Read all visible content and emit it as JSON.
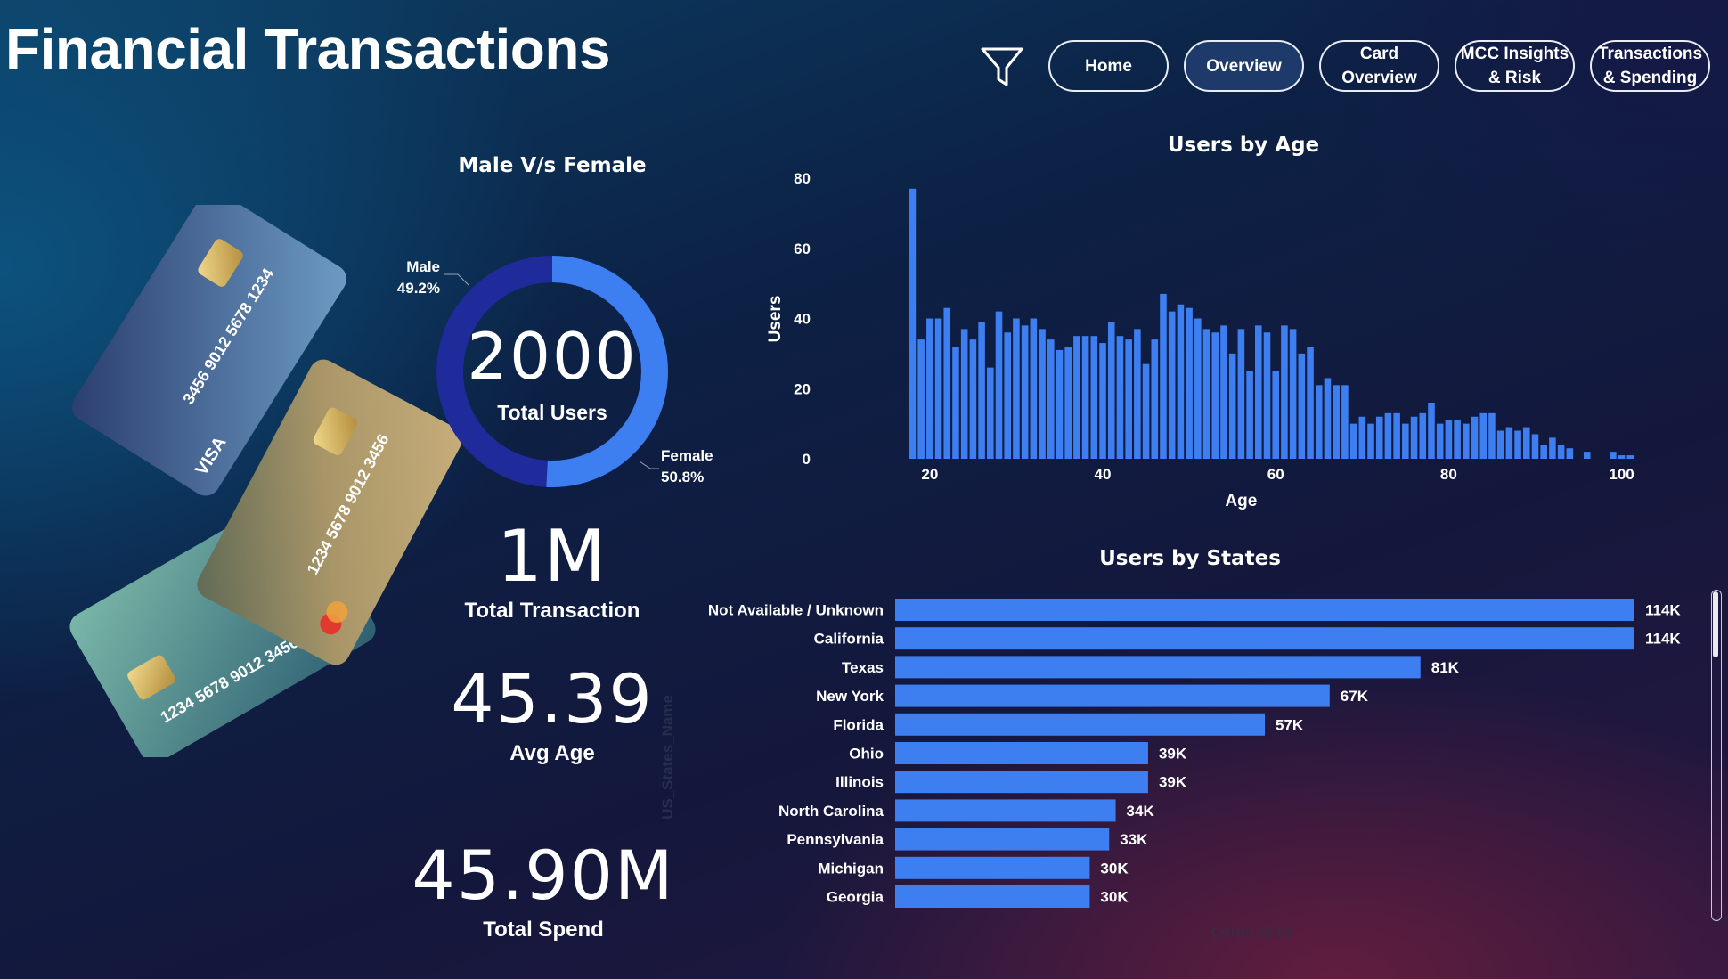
{
  "app_title": "Financial Transactions",
  "nav": {
    "filter_icon": "funnel-icon",
    "home": "Home",
    "overview": "Overview",
    "card_overview_line1": "Card",
    "card_overview_line2": "Overview",
    "mcc_line1": "MCC Insights",
    "mcc_line2": "& Risk",
    "trans_line1": "Transactions",
    "trans_line2": "& Spending",
    "active": "Overview"
  },
  "gender": {
    "title": "Male V/s Female",
    "total_users": "2000",
    "total_users_label": "Total Users",
    "male_label": "Male",
    "male_pct_text": "49.2%",
    "male_pct": 49.2,
    "female_label": "Female",
    "female_pct_text": "50.8%",
    "female_pct": 50.8,
    "male_color": "#1f2a9b",
    "female_color": "#3d7ef0"
  },
  "kpis": {
    "total_transaction": "1M",
    "total_transaction_label": "Total Transaction",
    "avg_age": "45.39",
    "avg_age_label": "Avg Age",
    "total_spend": "45.90M",
    "total_spend_label": "Total Spend"
  },
  "chart_data": [
    {
      "type": "bar",
      "title": "Users by Age",
      "xlabel": "Age",
      "ylabel": "Users",
      "x_ticks": [
        20,
        40,
        60,
        80,
        100
      ],
      "y_ticks": [
        0,
        20,
        40,
        60,
        80
      ],
      "xlim": [
        16,
        102
      ],
      "ylim": [
        0,
        80
      ],
      "bar_color": "#3d7ef0",
      "x": [
        18,
        19,
        20,
        21,
        22,
        23,
        24,
        25,
        26,
        27,
        28,
        29,
        30,
        31,
        32,
        33,
        34,
        35,
        36,
        37,
        38,
        39,
        40,
        41,
        42,
        43,
        44,
        45,
        46,
        47,
        48,
        49,
        50,
        51,
        52,
        53,
        54,
        55,
        56,
        57,
        58,
        59,
        60,
        61,
        62,
        63,
        64,
        65,
        66,
        67,
        68,
        69,
        70,
        71,
        72,
        73,
        74,
        75,
        76,
        77,
        78,
        79,
        80,
        81,
        82,
        83,
        84,
        85,
        86,
        87,
        88,
        89,
        90,
        91,
        92,
        93,
        94,
        96,
        99,
        100,
        101
      ],
      "values": [
        77,
        34,
        40,
        40,
        43,
        32,
        37,
        34,
        39,
        26,
        42,
        36,
        40,
        38,
        40,
        37,
        34,
        31,
        32,
        35,
        35,
        35,
        33,
        39,
        35,
        34,
        37,
        27,
        34,
        47,
        42,
        44,
        43,
        40,
        37,
        36,
        38,
        30,
        37,
        25,
        38,
        36,
        25,
        38,
        37,
        30,
        32,
        21,
        23,
        21,
        21,
        10,
        12,
        10,
        12,
        13,
        13,
        10,
        12,
        13,
        16,
        10,
        11,
        11,
        10,
        12,
        13,
        13,
        8,
        9,
        8,
        9,
        7,
        4,
        6,
        4,
        3,
        2,
        2,
        1,
        1
      ]
    },
    {
      "type": "bar",
      "orientation": "horizontal",
      "title": "Users by States",
      "ylabel": "US_States_Name",
      "xlabel": "Count of ID",
      "bar_color": "#3d7ef0",
      "categories": [
        "Not Available / Unknown",
        "California",
        "Texas",
        "New York",
        "Florida",
        "Ohio",
        "Illinois",
        "North Carolina",
        "Pennsylvania",
        "Michigan",
        "Georgia"
      ],
      "values": [
        114000,
        114000,
        81000,
        67000,
        57000,
        39000,
        39000,
        34000,
        33000,
        30000,
        30000
      ],
      "labels": [
        "114K",
        "114K",
        "81K",
        "67K",
        "57K",
        "39K",
        "39K",
        "34K",
        "33K",
        "30K",
        "30K"
      ]
    }
  ]
}
